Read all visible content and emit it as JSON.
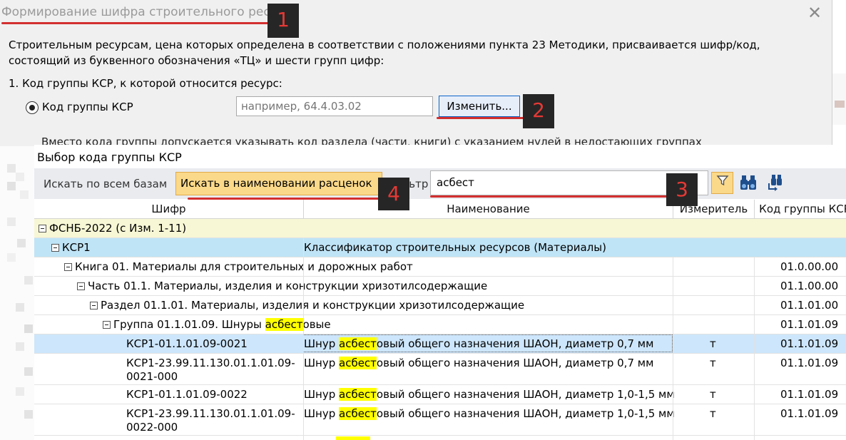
{
  "bg_dialog": {
    "title": "Формирование шифра строительного ресурса",
    "close_glyph": "✕",
    "description": "Строительным ресурсам, цена которых определена в соответствии с положениями пункта 23 Методики, присваивается шифр/код, состоящий из буквенного обозначения «ТЦ» и шести групп цифр:",
    "step1": "1. Код группы КСР, к которой относится ресурс:",
    "radio_label": "Код группы КСР",
    "code_placeholder": "например, 64.4.03.02",
    "change_button": "Изменить...",
    "clipped_text": "Вместо кода группы допускается указывать код раздела (части, книги) с указанием нулей в недостающих группах"
  },
  "front": {
    "title": "Выбор кода группы КСР",
    "toolbar": {
      "search_all_label": "Искать по всем базам",
      "search_names_label": "Искать в наименовании расценок",
      "filter_label": "Фильтр",
      "filter_value": "асбест",
      "dropdown_glyph": "▾",
      "filter_icon": "funnel-icon",
      "find_icon": "binoculars-icon",
      "find_next_icon": "binoculars-arrow-icon"
    },
    "columns": [
      "Шифр",
      "Наименование",
      "Измеритель",
      "Код группы КСР"
    ],
    "rows": [
      {
        "code": "ФСНБ-2022 (с Изм. 1-11)",
        "name": "",
        "unit": "",
        "group": ""
      },
      {
        "code": "КСР1",
        "name": "Классификатор строительных ресурсов (Материалы)",
        "unit": "",
        "group": ""
      },
      {
        "code": "Книга 01. Материалы для строительных и дорожных работ",
        "name": "",
        "unit": "",
        "group": "01.0.00.00"
      },
      {
        "code": "Часть 01.1. Материалы, изделия и конструкции хризотилсодержащие",
        "name": "",
        "unit": "",
        "group": "01.1.00.00"
      },
      {
        "code": "Раздел 01.1.01. Материалы, изделия и конструкции хризотилсодержащие",
        "name": "",
        "unit": "",
        "group": "01.1.01.00"
      },
      {
        "code_prefix": "Группа 01.1.01.09. Шнуры ",
        "code_hl": "асбест",
        "code_suffix": "овые",
        "name": "",
        "unit": "",
        "group": "01.1.01.09"
      },
      {
        "code": "КСР1-01.1.01.09-0021",
        "name_prefix": "Шнур ",
        "name_hl": "асбест",
        "name_suffix": "овый общего назначения ШАОН, диаметр 0,7 мм",
        "unit": "т",
        "group": "01.1.01.09"
      },
      {
        "code_line1": "КСР1-23.99.11.130.01.1.01.09-",
        "code_line2": "0021-000",
        "name_prefix": "Шнур ",
        "name_hl": "асбест",
        "name_suffix": "овый общего назначения ШАОН, диаметр 0,7 мм",
        "unit": "т",
        "group": "01.1.01.09"
      },
      {
        "code": "КСР1-01.1.01.09-0022",
        "name_prefix": "Шнур ",
        "name_hl": "асбест",
        "name_suffix": "овый общего назначения ШАОН, диаметр 1,0-1,5 мм",
        "unit": "т",
        "group": "01.1.01.09"
      },
      {
        "code_line1": "КСР1-23.99.11.130.01.1.01.09-",
        "code_line2": "0022-000",
        "name_prefix": "Шнур ",
        "name_hl": "асбест",
        "name_suffix": "овый общего назначения ШАОН, диаметр 1,0-1,5 мм",
        "unit": "т",
        "group": "01.1.01.09"
      }
    ]
  },
  "badges": [
    "1",
    "2",
    "3",
    "4"
  ],
  "colors": {
    "underline": "#d32f2f",
    "badge_bg": "#262626",
    "badge_text": "#e53935",
    "highlight": "#ffff00",
    "active_button": "#fbd98a",
    "root_row": "#f7f7d6",
    "ksr_row": "#bfe4f6",
    "selected_row": "#cde6fb"
  }
}
